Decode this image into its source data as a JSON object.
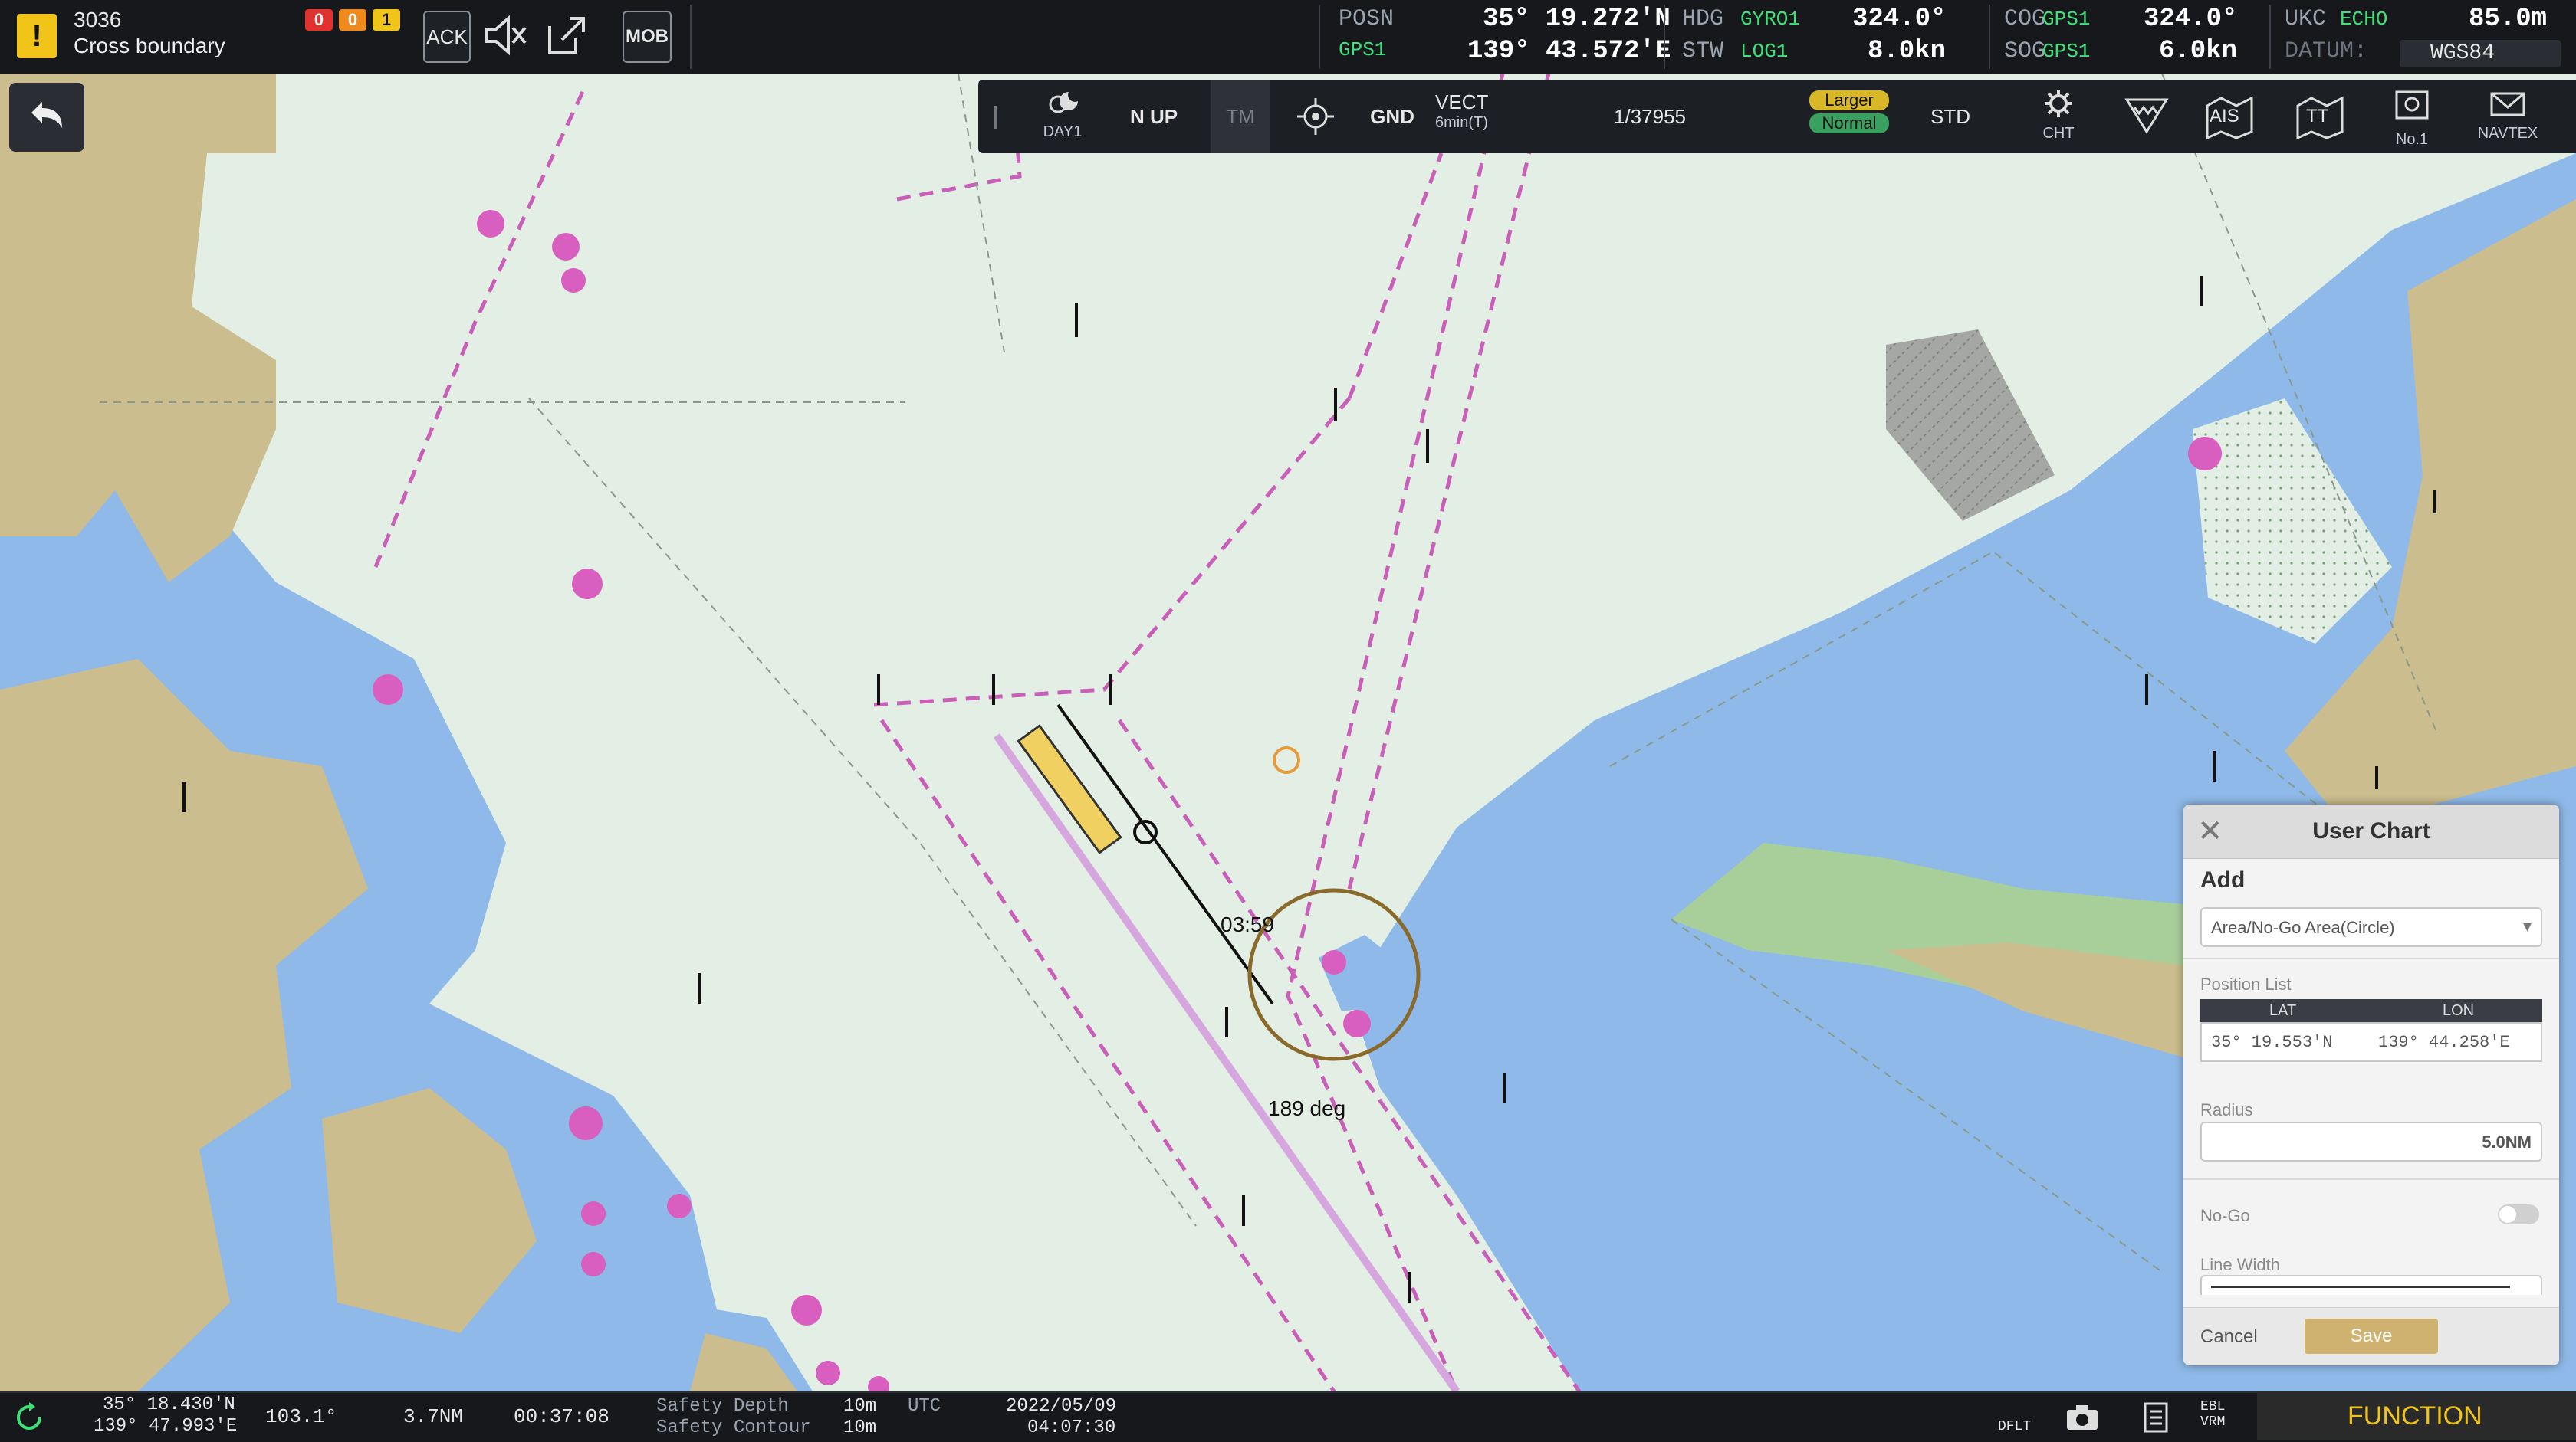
{
  "alert": {
    "id": "3036",
    "message": "Cross boundary",
    "counters": [
      "0",
      "0",
      "1"
    ]
  },
  "alert_buttons": {
    "ack": "ACK",
    "mob": "MOB"
  },
  "nav": {
    "posn": {
      "label": "POSN",
      "source": "GPS1",
      "lat": "35° 19.272'N",
      "lon": "139° 43.572'E"
    },
    "hdg": {
      "label": "HDG",
      "source": "GYRO1",
      "value": "324.0°"
    },
    "stw": {
      "label": "STW",
      "source": "LOG1",
      "value": "8.0kn"
    },
    "cog": {
      "label": "COG",
      "source": "GPS1",
      "value": "324.0°"
    },
    "sog": {
      "label": "SOG",
      "source": "GPS1",
      "value": "6.0kn"
    },
    "ukc": {
      "label": "UKC",
      "source": "ECHO",
      "value": "85.0m"
    },
    "datum": {
      "label": "DATUM:",
      "value": "WGS84"
    }
  },
  "toolbar": {
    "day": "DAY1",
    "orientation": "N UP",
    "tm": "TM",
    "gnd": "GND",
    "vect": "VECT",
    "vect_sub": "6min(T)",
    "scale": "1/37955",
    "larger": "Larger",
    "normal": "Normal",
    "std": "STD",
    "cht": "CHT",
    "ais": "AIS",
    "tt": "TT",
    "no1": "No.1",
    "navtex": "NAVTEX"
  },
  "chart_labels": {
    "time_label": "03:59",
    "bearing_label": "189 deg"
  },
  "user_chart": {
    "title": "User Chart",
    "section": "Add",
    "type_value": "Area/No-Go Area(Circle)",
    "position_list_label": "Position List",
    "lat_header": "LAT",
    "lon_header": "LON",
    "lat": "35° 19.553'N",
    "lon": "139° 44.258'E",
    "radius_label": "Radius",
    "radius_value": "5.0NM",
    "nogo_label": "No-Go",
    "nogo_on": false,
    "line_width_label": "Line Width",
    "cancel": "Cancel",
    "save": "Save"
  },
  "status": {
    "lat": "35° 18.430'N",
    "lon": "139° 47.993'E",
    "bearing": "103.1°",
    "range": "3.7NM",
    "ttg": "00:37:08",
    "safety_depth_label": "Safety Depth",
    "safety_depth": "10m",
    "safety_contour_label": "Safety Contour",
    "safety_contour": "10m",
    "tz": "UTC",
    "date": "2022/05/09",
    "time": "04:07:30",
    "dflt": "DFLT",
    "ebl_vrm": "EBL VRM",
    "function": "FUNCTION"
  },
  "colors": {
    "land": "#cbbd8e",
    "shallow": "#8fb9e8",
    "deep": "#e3efe4",
    "route": "#c95fb8",
    "accent": "#f0c419",
    "nav_src": "#3fe07a"
  }
}
